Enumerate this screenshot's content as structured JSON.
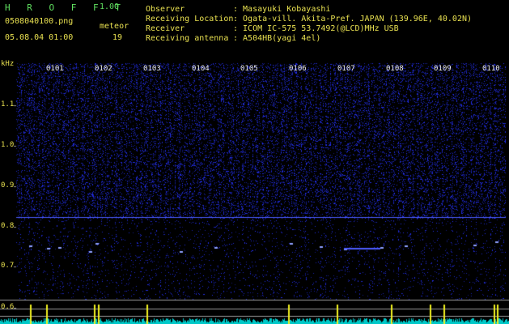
{
  "app": {
    "name": "H R O F F T",
    "version": "1.00"
  },
  "file": {
    "name": "0508040100.png",
    "datetime": "05.08.04 01:00"
  },
  "meteor": {
    "label": "meteor",
    "count": "19"
  },
  "info": {
    "observer_label": "Observer",
    "observer_value": ": Masayuki Kobayashi",
    "location_label": "Receiving Location",
    "location_value": ": Ogata-vill. Akita-Pref. JAPAN (139.96E, 40.02N)",
    "receiver_label": "Receiver",
    "receiver_value": ": ICOM IC-575 53.7492(@LCD)MHz USB",
    "antenna_label": "Receiving antenna",
    "antenna_value": ": A504HB(yagi 4el)"
  },
  "axis": {
    "unit": "kHz",
    "ticks": [
      "1.1",
      "1.0",
      "0.9",
      "0.8",
      "0.7",
      "0.6"
    ]
  },
  "minutes": [
    "0101",
    "0102",
    "0103",
    "0104",
    "0105",
    "0106",
    "0107",
    "0108",
    "0109",
    "0110"
  ],
  "colors": {
    "noise": "#1a2cc8",
    "trace": "#4d5cff",
    "baseline": "#00c8c8",
    "spike": "#f0f020",
    "grid": "#9a9a9a"
  }
}
